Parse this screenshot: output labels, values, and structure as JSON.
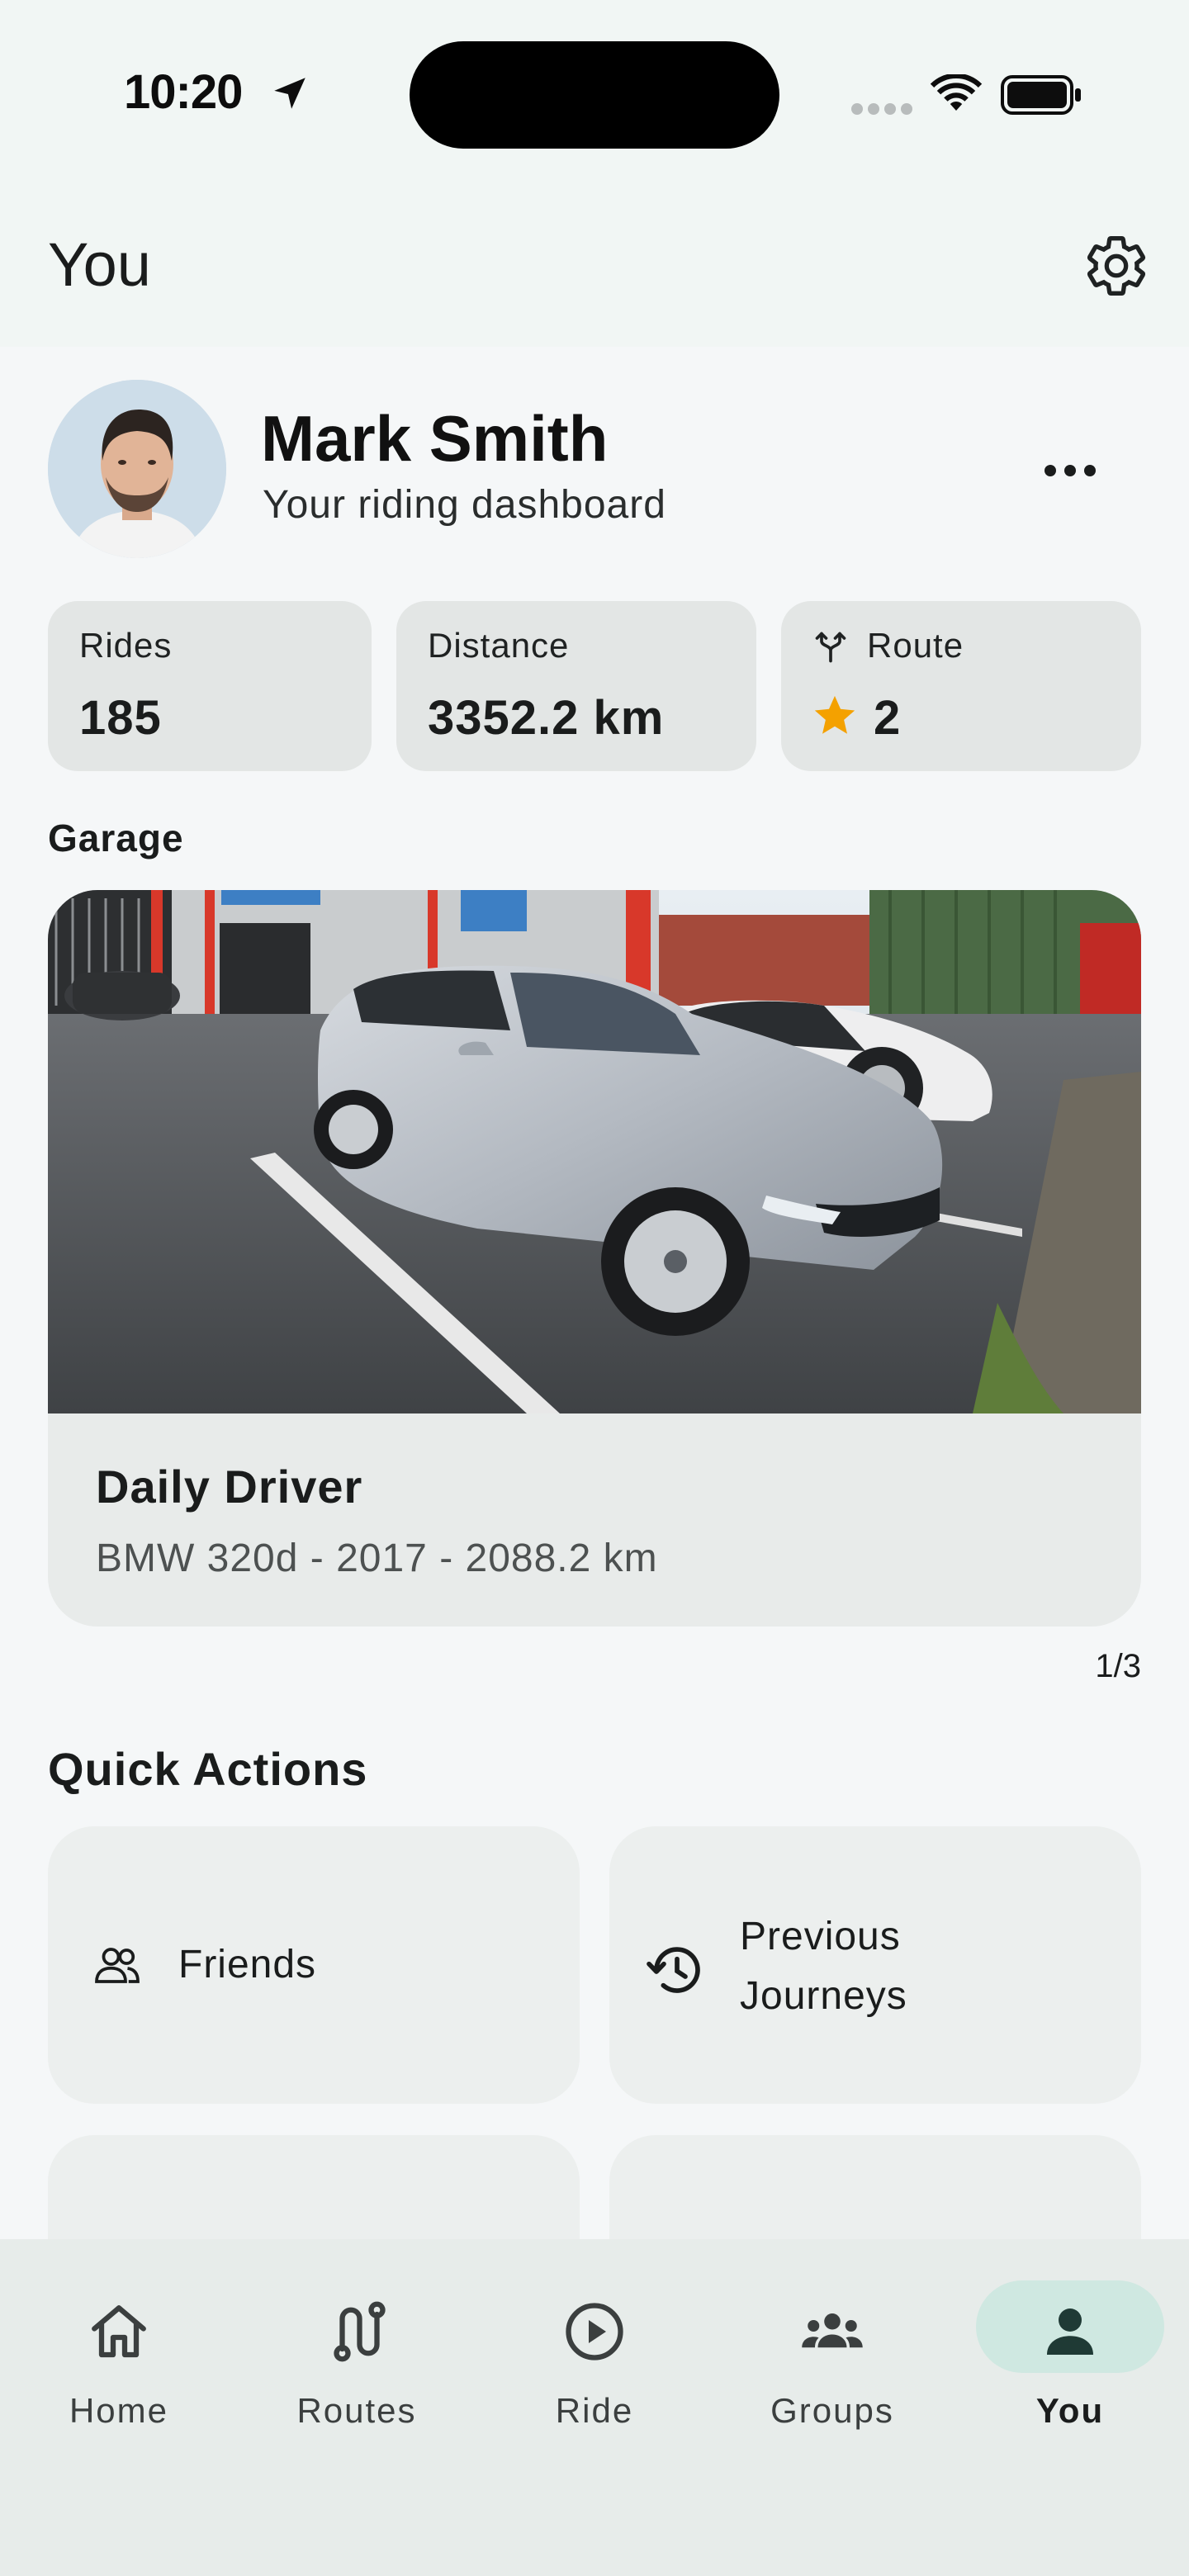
{
  "status_bar": {
    "time": "10:20"
  },
  "header": {
    "title": "You"
  },
  "profile": {
    "name": "Mark Smith",
    "subtitle": "Your riding dashboard"
  },
  "stats": [
    {
      "label": "Rides",
      "value": "185",
      "icon": null
    },
    {
      "label": "Distance",
      "value": "3352.2 km",
      "icon": null
    },
    {
      "label": "Route",
      "value": "2",
      "icon": "fork-icon",
      "value_icon": "star-icon",
      "value_icon_color": "#f4a100"
    }
  ],
  "garage": {
    "section_title": "Garage",
    "vehicle_name": "Daily Driver",
    "vehicle_details": "BMW 320d - 2017 - 2088.2 km",
    "pager": "1/3"
  },
  "quick_actions": {
    "section_title": "Quick Actions",
    "items": [
      {
        "label": "Friends",
        "icon": "people-icon"
      },
      {
        "label_lines": [
          "Previous",
          "Journeys"
        ],
        "icon": "history-icon"
      }
    ]
  },
  "bottom_nav": {
    "active": "You",
    "active_color": "#cfe8e1",
    "items": [
      {
        "label": "Home",
        "icon": "home-icon"
      },
      {
        "label": "Routes",
        "icon": "route-icon"
      },
      {
        "label": "Ride",
        "icon": "play-icon"
      },
      {
        "label": "Groups",
        "icon": "groups-icon"
      },
      {
        "label": "You",
        "icon": "person-icon"
      }
    ]
  }
}
